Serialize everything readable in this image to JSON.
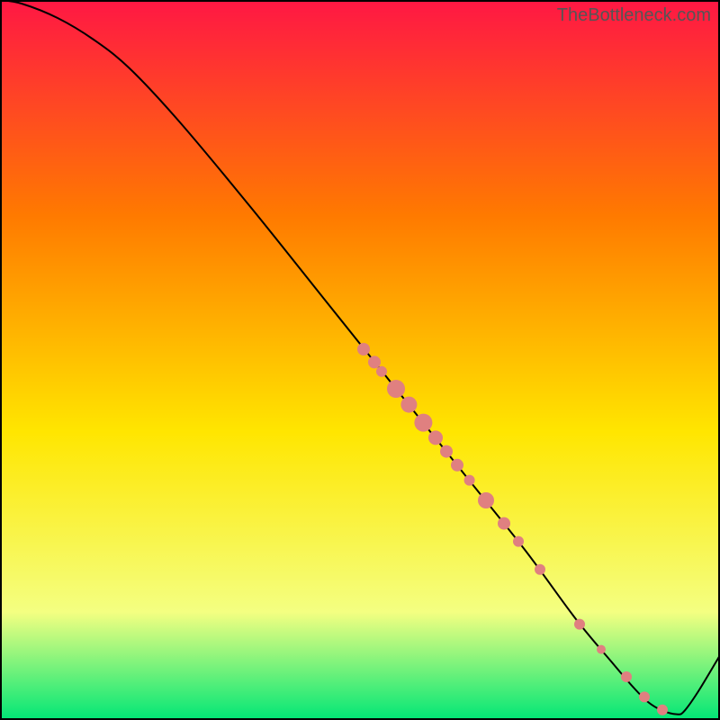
{
  "watermark": "TheBottleneck.com",
  "chart_data": {
    "type": "line",
    "title": "",
    "xlabel": "",
    "ylabel": "",
    "xlim": [
      0,
      100
    ],
    "ylim": [
      0,
      100
    ],
    "gradient": {
      "top_color": "#ff1744",
      "mid_upper_color": "#ff7a00",
      "mid_color": "#ffe600",
      "mid_lower_color": "#f4ff81",
      "bottom_color": "#00e676"
    },
    "line": {
      "points": [
        [
          0,
          100
        ],
        [
          3,
          99.5
        ],
        [
          8,
          97.5
        ],
        [
          13,
          94.5
        ],
        [
          18,
          90.5
        ],
        [
          25,
          83
        ],
        [
          35,
          71
        ],
        [
          45,
          58.5
        ],
        [
          55,
          46
        ],
        [
          65,
          33.5
        ],
        [
          73,
          23.5
        ],
        [
          80,
          14
        ],
        [
          85,
          8
        ],
        [
          88,
          4.5
        ],
        [
          90,
          2.5
        ],
        [
          92,
          1.3
        ],
        [
          94,
          0.8
        ],
        [
          95,
          1.2
        ],
        [
          97,
          4
        ],
        [
          100,
          9
        ]
      ]
    },
    "markers": {
      "color": "#e08080",
      "points": [
        [
          50.5,
          51.5,
          7
        ],
        [
          52.0,
          49.7,
          7
        ],
        [
          53.0,
          48.4,
          6
        ],
        [
          55.0,
          46.0,
          10
        ],
        [
          56.8,
          43.8,
          9
        ],
        [
          58.8,
          41.3,
          10
        ],
        [
          60.5,
          39.2,
          8
        ],
        [
          62.0,
          37.3,
          7
        ],
        [
          63.5,
          35.4,
          7
        ],
        [
          65.2,
          33.3,
          6
        ],
        [
          67.5,
          30.5,
          9
        ],
        [
          70.0,
          27.3,
          7
        ],
        [
          72.0,
          24.8,
          6
        ],
        [
          75.0,
          20.9,
          6
        ],
        [
          80.5,
          13.3,
          6
        ],
        [
          83.5,
          9.8,
          5
        ],
        [
          87.0,
          6.0,
          6
        ],
        [
          89.5,
          3.2,
          6
        ],
        [
          92.0,
          1.4,
          6
        ]
      ]
    }
  }
}
